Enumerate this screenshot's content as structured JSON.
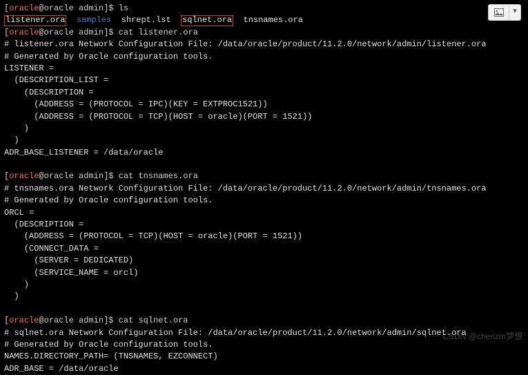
{
  "prompt": {
    "user": "oracle",
    "host": "oracle",
    "path": "admin",
    "open": "[",
    "at": "@",
    "close": "]",
    "sym": "$"
  },
  "cmd": {
    "ls": "ls",
    "cat_listener": "cat listener.ora",
    "cat_tns": "cat tnsnames.ora",
    "cat_sqlnet": "cat sqlnet.ora"
  },
  "ls": {
    "f1": "listener.ora",
    "d1": "samples",
    "f2": "shrept.lst",
    "f3": "sqlnet.ora",
    "f4": "tnsnames.ora"
  },
  "listener": {
    "l1": "# listener.ora Network Configuration File: /data/oracle/product/11.2.0/network/admin/listener.ora",
    "l2": "# Generated by Oracle configuration tools.",
    "l3": "",
    "l4": "LISTENER =",
    "l5": "  (DESCRIPTION_LIST =",
    "l6": "    (DESCRIPTION =",
    "l7": "      (ADDRESS = (PROTOCOL = IPC)(KEY = EXTPROC1521))",
    "l8": "      (ADDRESS = (PROTOCOL = TCP)(HOST = oracle)(PORT = 1521))",
    "l9": "    )",
    "l10": "  )",
    "l11": "",
    "l12": "ADR_BASE_LISTENER = /data/oracle"
  },
  "tns": {
    "l1": "# tnsnames.ora Network Configuration File: /data/oracle/product/11.2.0/network/admin/tnsnames.ora",
    "l2": "# Generated by Oracle configuration tools.",
    "l3": "",
    "l4": "ORCL =",
    "l5": "  (DESCRIPTION =",
    "l6": "    (ADDRESS = (PROTOCOL = TCP)(HOST = oracle)(PORT = 1521))",
    "l7": "    (CONNECT_DATA =",
    "l8": "      (SERVER = DEDICATED)",
    "l9": "      (SERVICE_NAME = orcl)",
    "l10": "    )",
    "l11": "  )"
  },
  "sqlnet": {
    "l1": "# sqlnet.ora Network Configuration File: /data/oracle/product/11.2.0/network/admin/sqlnet.ora",
    "l2": "# Generated by Oracle configuration tools.",
    "l3": "",
    "l4": "NAMES.DIRECTORY_PATH= (TNSNAMES, EZCONNECT)",
    "l5": "",
    "l6": "ADR_BASE = /data/oracle"
  },
  "toolbar": {
    "dropdown_glyph": "▾",
    "img_alt": "image"
  },
  "watermark": "CSDN @chenzm梦想"
}
